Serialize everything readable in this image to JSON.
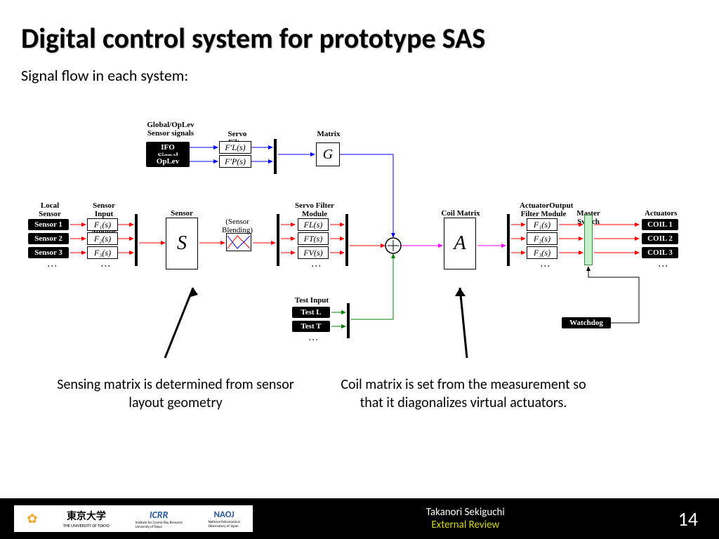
{
  "title": "Digital control system for prototype SAS",
  "subtitle": "Signal flow in each system:",
  "labels": {
    "global": "Global/OpLev\nSensor signals",
    "servo1": "Servo Filter",
    "matrix": "Matrix",
    "local": "Local\nSensor signals",
    "sensorinput": "Sensor Input\nFilter Module",
    "sensormatrix": "Sensor Matrix",
    "blending": "(Sensor\nBlending)",
    "servo2": "Servo Filter\nModule",
    "coilmatrix": "Coil Matrix",
    "actuator": "ActuatorOutput\nFilter Module",
    "master": "Master Switch",
    "actuators": "Actuators",
    "testinput": "Test Input"
  },
  "boxes": {
    "ifo": "IFO Signal",
    "oplev": "OpLev",
    "fprime_l": "F′L(s)",
    "fprime_p": "F′P(s)",
    "g": "G",
    "sensor1": "Sensor 1",
    "sensor2": "Sensor 2",
    "sensor3": "Sensor 3",
    "f1": "F₁(s)",
    "f2": "F₂(s)",
    "f3": "F₃(s)",
    "s": "S",
    "fl": "FL(s)",
    "ft": "FT(s)",
    "fv": "FV(s)",
    "a": "A",
    "af1": "F₁(s)",
    "af2": "F₂(s)",
    "af3": "F₃(s)",
    "coil1": "COIL 1",
    "coil2": "COIL 2",
    "coil3": "COIL 3",
    "testl": "Test L",
    "testt": "Test T",
    "watchdog": "Watchdog"
  },
  "notes": {
    "left": "Sensing matrix is determined from sensor layout geometry",
    "right": "Coil matrix is set from the measurement so that it diagonalizes virtual actuators."
  },
  "footer": {
    "tokyo": "東京大学",
    "tokyo_en": "THE UNIVERSITY OF TOKYO",
    "icrr": "ICRR",
    "icrr_sub": "Institute for Cosmic Ray Research\nUniversity of Tokyo",
    "naoj": "NAOJ",
    "naoj_sub": "National Astronomical\nObservatory of Japan",
    "author": "Takanori Sekiguchi",
    "review": "External Review",
    "page": "14"
  }
}
